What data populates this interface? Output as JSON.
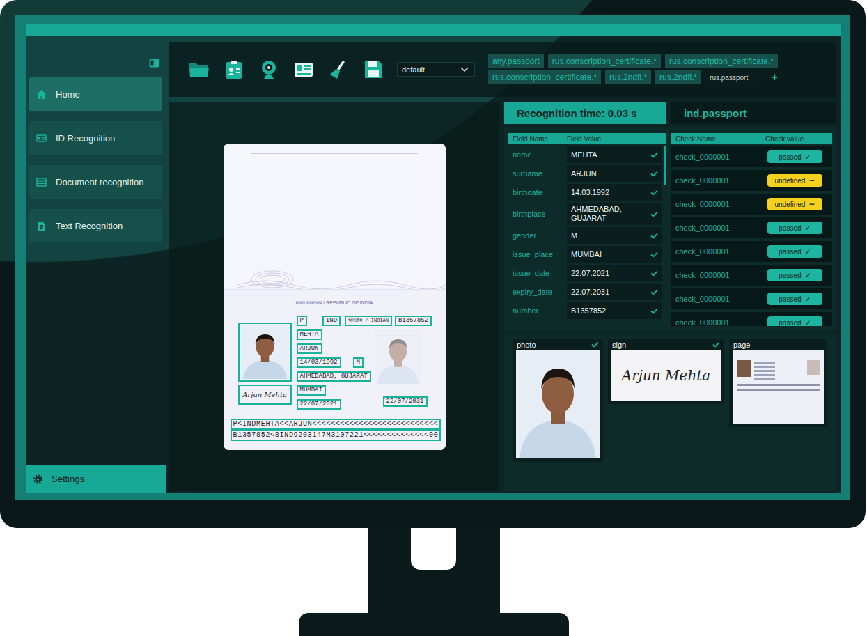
{
  "sidebar": {
    "items": [
      {
        "label": "Home",
        "selected": true
      },
      {
        "label": "ID Recognition",
        "selected": false
      },
      {
        "label": "Document recognition",
        "selected": false
      },
      {
        "label": "Text Recognition",
        "selected": false
      }
    ],
    "settings": "Settings"
  },
  "toolbar": {
    "profile": "default",
    "tags": [
      "any.passport",
      "rus.conscription_certificate.*",
      "rus.conscription_certificate.*",
      "rus.conscription_certificate.*",
      "rus.2ndfl.*",
      "rus.2ndfl.*"
    ],
    "tag_input": "rus.passport",
    "add_button": "+"
  },
  "document": {
    "header": "भारत गणराज्य / REPUBLIC OF INDIA",
    "type": "P",
    "country": "IND",
    "nationality": "भारतीय / INDIAN",
    "number": "B1357852",
    "surname": "MEHTA",
    "given_name": "ARJUN",
    "birthdate": "14/03/1992",
    "gender": "M",
    "birthplace": "AHMEDABAD, GUJARAT",
    "issue_place": "MUMBAI",
    "issue_date": "22/07/2021",
    "expiry_date": "22/07/2031",
    "signature": "Arjun Mehta",
    "mrz": [
      "P<INDMEHTA<<ARJUN<<<<<<<<<<<<<<<<<<<<<<<<<<<",
      "B1357852<8IND9203147M3107221<<<<<<<<<<<<<<00"
    ]
  },
  "result": {
    "time": "Recognition time: 0.03 s",
    "doc_type": "ind.passport",
    "field_columns": [
      "Field Name",
      "Field Value"
    ],
    "fields": [
      {
        "name": "name",
        "value": "MEHTA",
        "valid": true
      },
      {
        "name": "surname",
        "value": "ARJUN",
        "valid": true
      },
      {
        "name": "birthdate",
        "value": "14.03.1992",
        "valid": true
      },
      {
        "name": "birthplace",
        "value": "AHMEDABAD, GUJARAT",
        "valid": true
      },
      {
        "name": "gender",
        "value": "M",
        "valid": true
      },
      {
        "name": "issue_place",
        "value": "MUMBAI",
        "valid": true
      },
      {
        "name": "issue_date",
        "value": "22.07.2021",
        "valid": true
      },
      {
        "name": "expiry_date",
        "value": "22.07.2031",
        "valid": true
      },
      {
        "name": "number",
        "value": "B1357852",
        "valid": true
      }
    ],
    "check_columns": [
      "Check Name",
      "Check value"
    ],
    "checks": [
      {
        "name": "check_0000001",
        "value": "passed",
        "icon": "✓",
        "color": "#1db5a0"
      },
      {
        "name": "check_0000001",
        "value": "undefined",
        "icon": "~",
        "color": "#f4d11c"
      },
      {
        "name": "check_0000001",
        "value": "undefined",
        "icon": "~",
        "color": "#f4d11c"
      },
      {
        "name": "check_0000001",
        "value": "passed",
        "icon": "✓",
        "color": "#1db5a0"
      },
      {
        "name": "check_0000001",
        "value": "passed",
        "icon": "✓",
        "color": "#1db5a0"
      },
      {
        "name": "check_0000001",
        "value": "passed",
        "icon": "✓",
        "color": "#1db5a0"
      },
      {
        "name": "check_0000001",
        "value": "passed",
        "icon": "✓",
        "color": "#1db5a0"
      },
      {
        "name": "check_0000001",
        "value": "passed",
        "icon": "✓",
        "color": "#1db5a0"
      }
    ]
  },
  "images": [
    {
      "label": "photo",
      "valid": true
    },
    {
      "label": "sign",
      "valid": true,
      "signature": "Arjun Mehta"
    },
    {
      "label": "page",
      "valid": false
    }
  ]
}
